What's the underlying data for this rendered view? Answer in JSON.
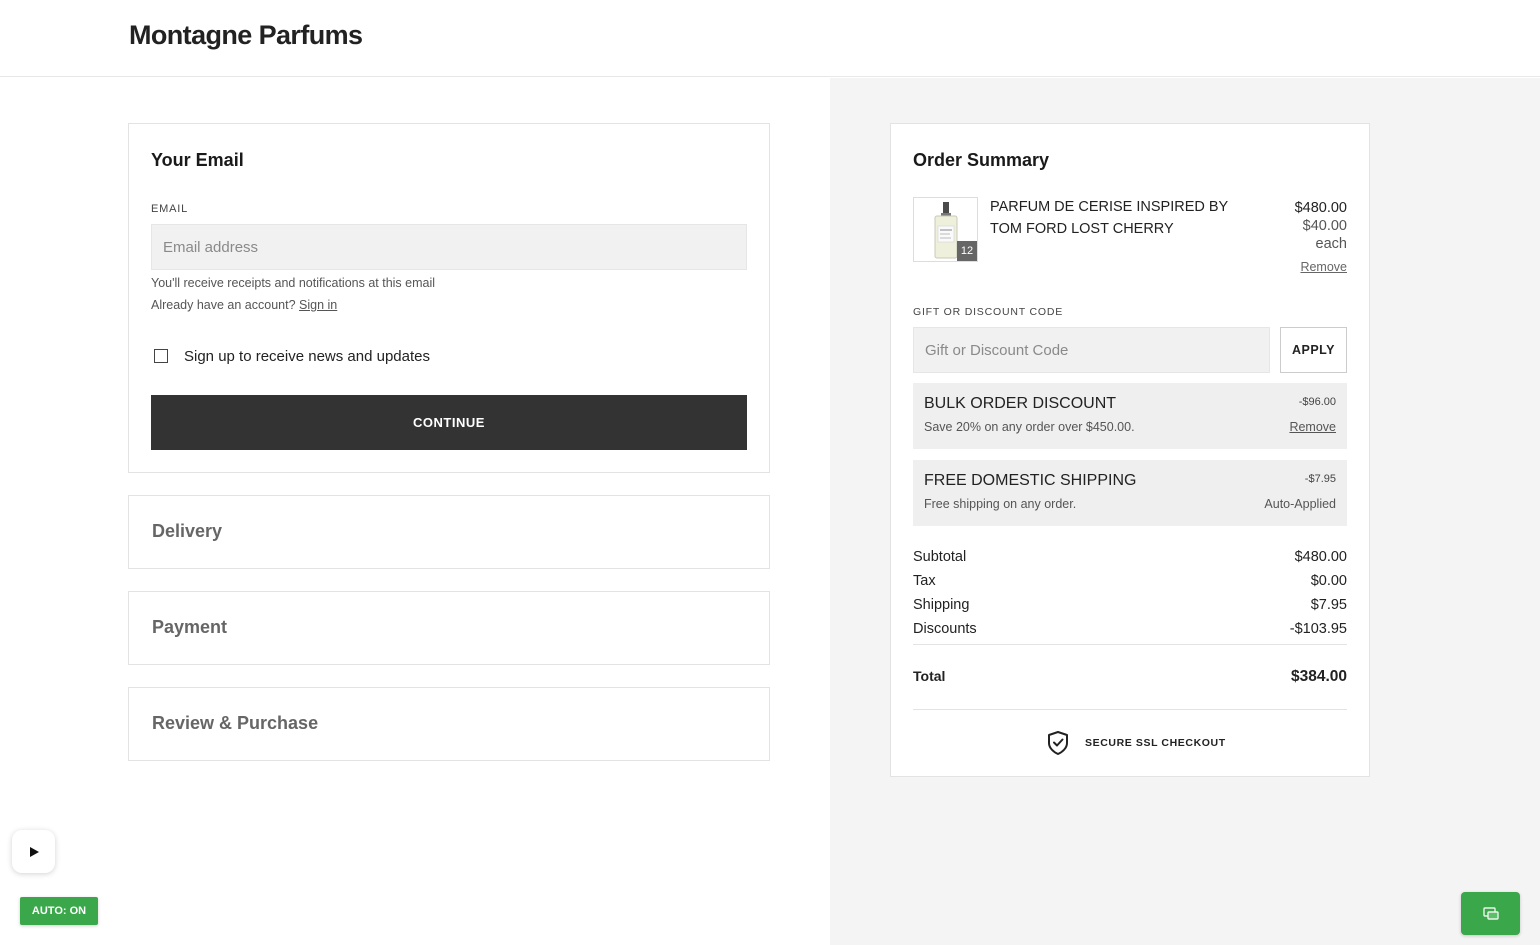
{
  "brand": {
    "name": "Montagne Parfums"
  },
  "email_section": {
    "title": "Your Email",
    "label": "EMAIL",
    "placeholder": "Email address",
    "hint": "You'll receive receipts and notifications at this email",
    "account_prompt": "Already have an account?",
    "sign_in": "Sign in",
    "newsletter_label": "Sign up to receive news and updates",
    "continue": "CONTINUE"
  },
  "steps": [
    "Delivery",
    "Payment",
    "Review & Purchase"
  ],
  "summary": {
    "title": "Order Summary",
    "item": {
      "name": "PARFUM DE CERISE INSPIRED BY TOM FORD LOST CHERRY",
      "quantity": "12",
      "total": "$480.00",
      "unit_price": "$40.00",
      "unit_label": "each",
      "remove": "Remove"
    },
    "discount_code": {
      "label": "GIFT OR DISCOUNT CODE",
      "placeholder": "Gift or Discount Code",
      "apply": "APPLY"
    },
    "discounts": [
      {
        "title": "BULK ORDER DISCOUNT",
        "description": "Save 20% on any order over $450.00.",
        "amount": "-$96.00",
        "action": "Remove"
      },
      {
        "title": "FREE DOMESTIC SHIPPING",
        "description": "Free shipping on any order.",
        "amount": "-$7.95",
        "action": "Auto-Applied"
      }
    ],
    "lines": [
      {
        "label": "Subtotal",
        "value": "$480.00"
      },
      {
        "label": "Tax",
        "value": "$0.00"
      },
      {
        "label": "Shipping",
        "value": "$7.95"
      },
      {
        "label": "Discounts",
        "value": "-$103.95"
      }
    ],
    "total": {
      "label": "Total",
      "value": "$384.00"
    },
    "secure": "SECURE SSL CHECKOUT"
  },
  "overlay": {
    "auto_label": "AUTO: ON"
  },
  "colors": {
    "dark_button": "#333333",
    "green": "#3aa84a",
    "sidebar_bg": "#f4f4f4"
  }
}
